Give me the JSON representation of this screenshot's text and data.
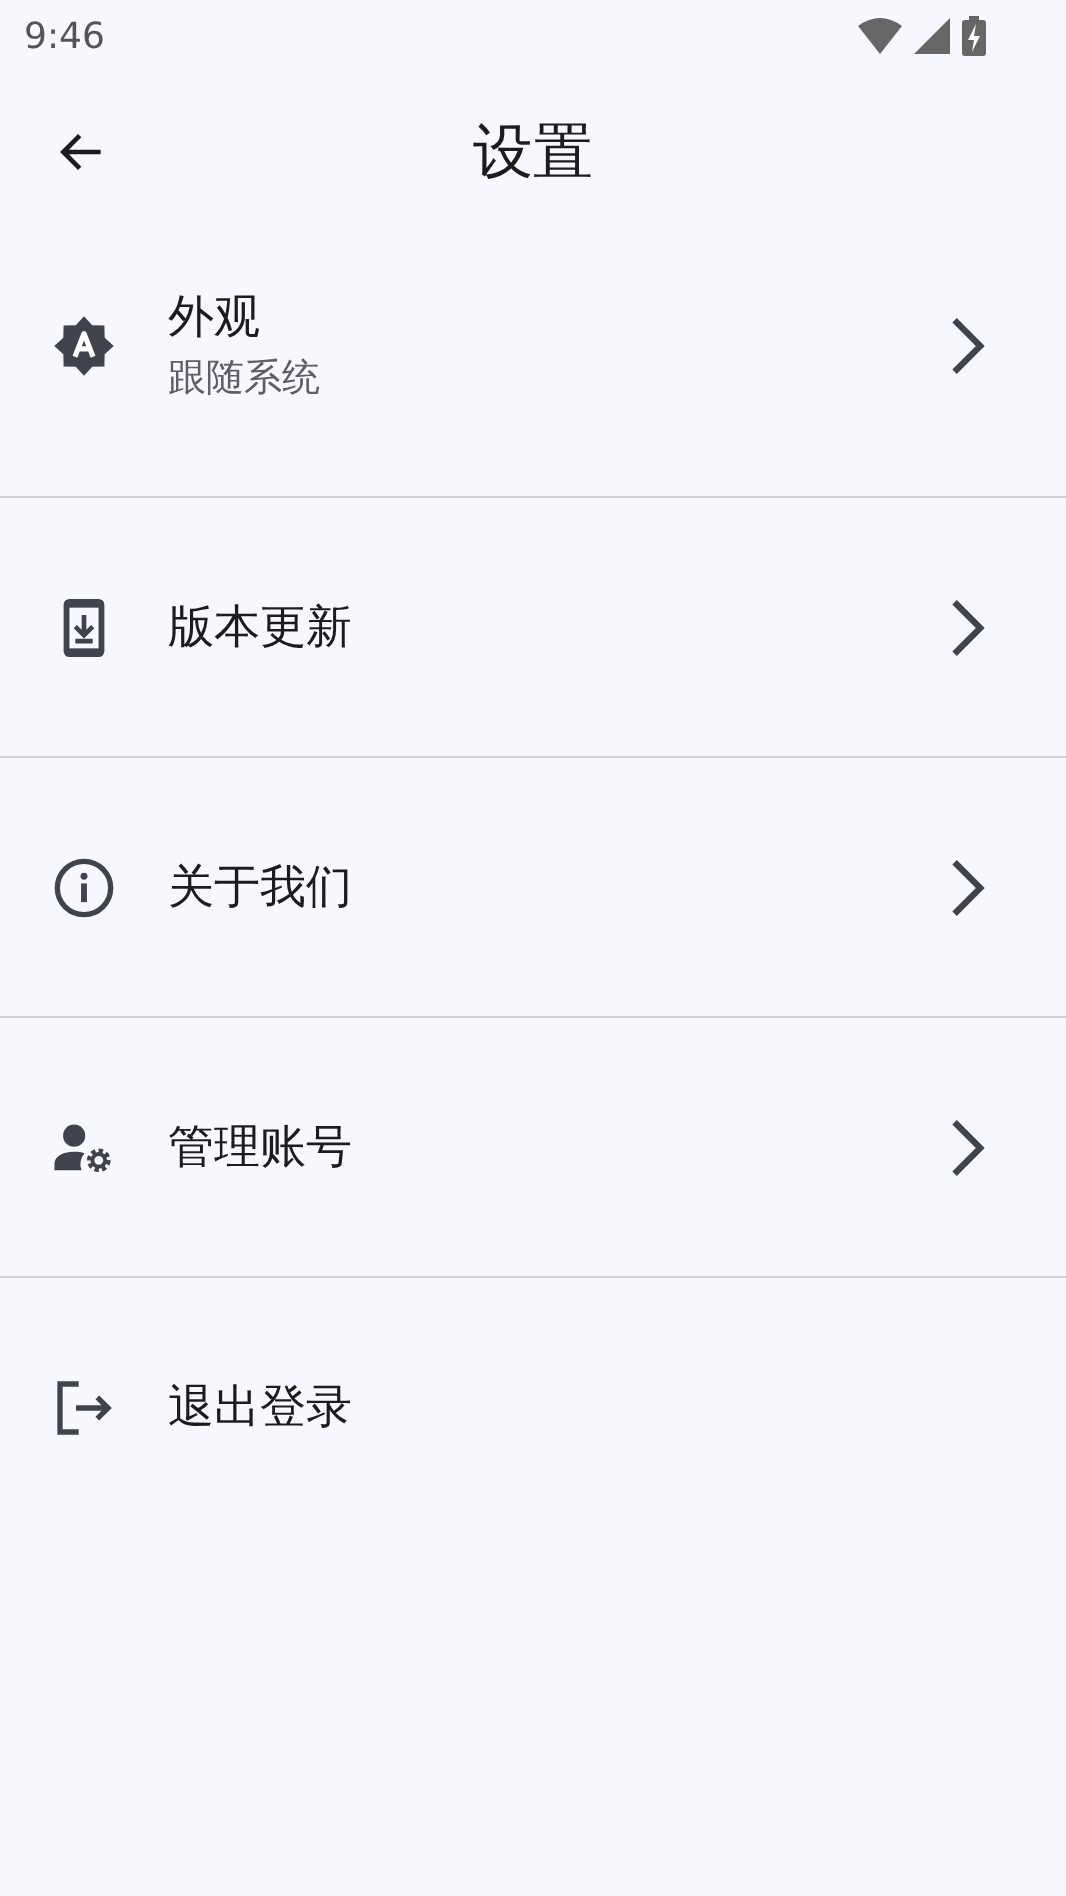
{
  "status_bar": {
    "time": "9:46"
  },
  "header": {
    "title": "设置"
  },
  "items": [
    {
      "kind": "appearance",
      "title": "外观",
      "subtitle": "跟随系统",
      "chevron": true
    },
    {
      "kind": "update",
      "title": "版本更新",
      "chevron": true
    },
    {
      "kind": "info",
      "title": "关于我们",
      "chevron": true
    },
    {
      "kind": "account",
      "title": "管理账号",
      "chevron": true
    },
    {
      "kind": "logout",
      "title": "退出登录",
      "chevron": false
    }
  ]
}
